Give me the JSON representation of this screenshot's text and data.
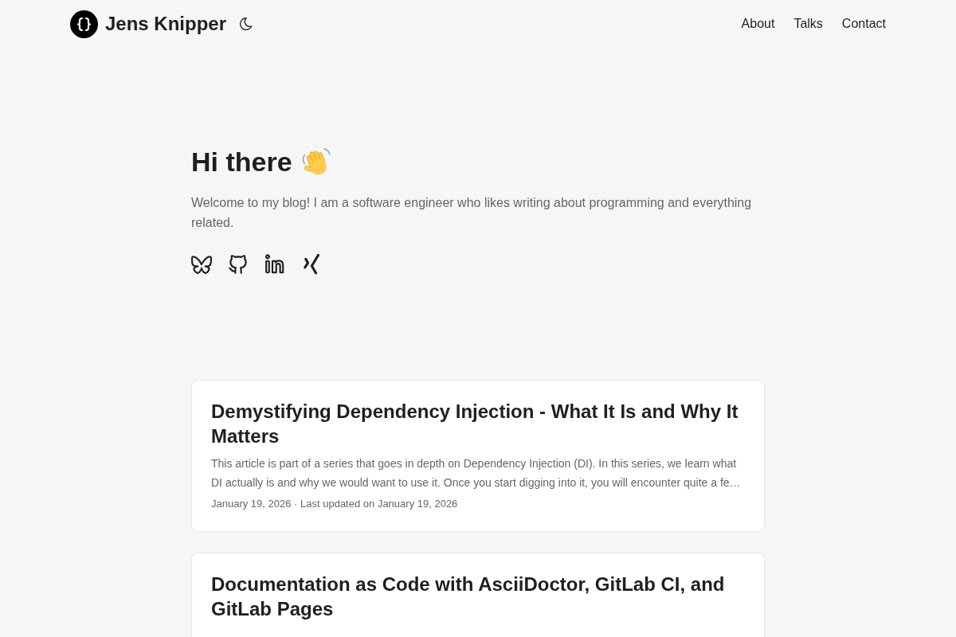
{
  "header": {
    "site_title": "Jens Knipper",
    "nav": [
      {
        "label": "About"
      },
      {
        "label": "Talks"
      },
      {
        "label": "Contact"
      }
    ]
  },
  "intro": {
    "heading": "Hi there",
    "text": "Welcome to my blog! I am a software engineer who likes writing about programming and everything related.",
    "social_links": [
      {
        "kind": "bluesky"
      },
      {
        "kind": "github"
      },
      {
        "kind": "linkedin"
      },
      {
        "kind": "xing"
      }
    ]
  },
  "posts": [
    {
      "title": "Demystifying Dependency Injection - What It Is and Why It Matters",
      "summary": "This article is part of a series that goes in depth on Dependency Injection (DI). In this series, we learn what DI actually is and why we would want to use it. Once you start digging into it, you will encounter quite a fe…",
      "meta": "January 19, 2026 · Last updated on January 19, 2026"
    },
    {
      "title": "Documentation as Code with AsciiDoctor, GitLab CI, and GitLab Pages"
    }
  ]
}
